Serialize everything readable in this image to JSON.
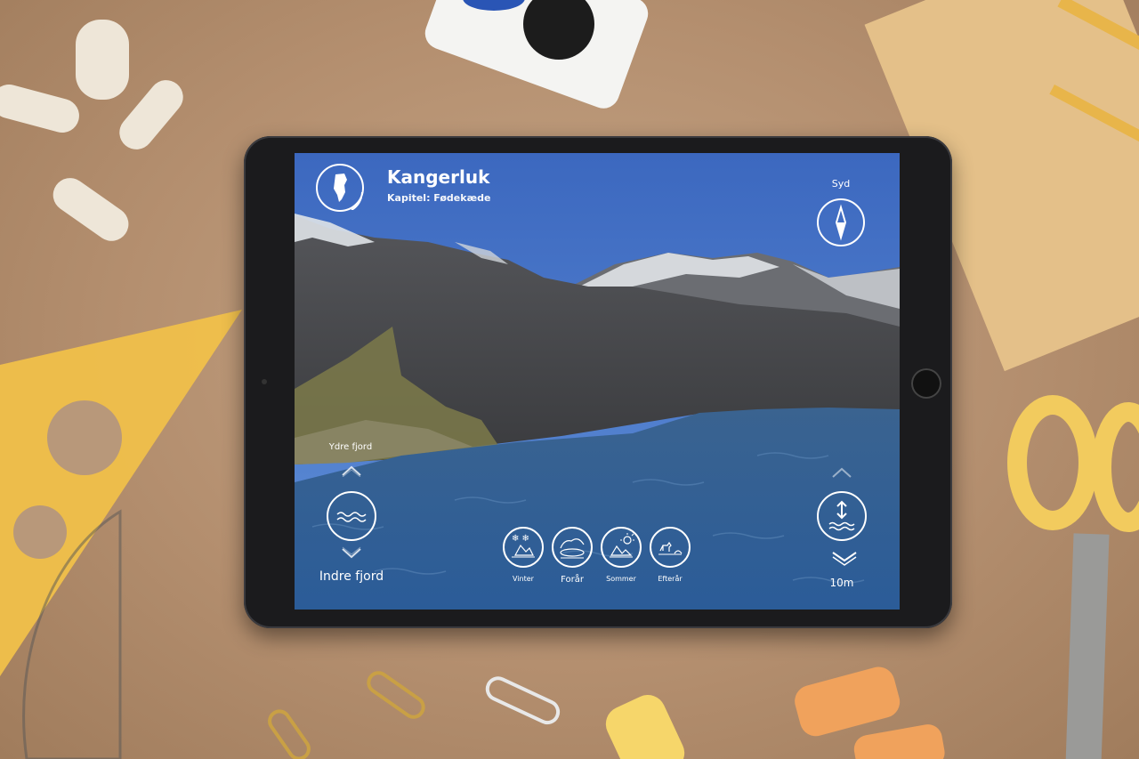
{
  "app": {
    "title": "Kangerluk",
    "chapter": "Kapitel: Fødekæde"
  },
  "compass": {
    "direction": "Syd"
  },
  "location": {
    "upper_label": "Ydre fjord",
    "current_label": "Indre fjord"
  },
  "depth": {
    "value": "10m"
  },
  "seasons": [
    {
      "label": "Vinter",
      "icon": "winter-icon"
    },
    {
      "label": "Forår",
      "icon": "spring-icon"
    },
    {
      "label": "Sommer",
      "icon": "summer-icon"
    },
    {
      "label": "Efterår",
      "icon": "autumn-icon"
    }
  ],
  "colors": {
    "sky": "#3f6fc0",
    "water": "#2f5f93",
    "ui": "#ffffff"
  }
}
